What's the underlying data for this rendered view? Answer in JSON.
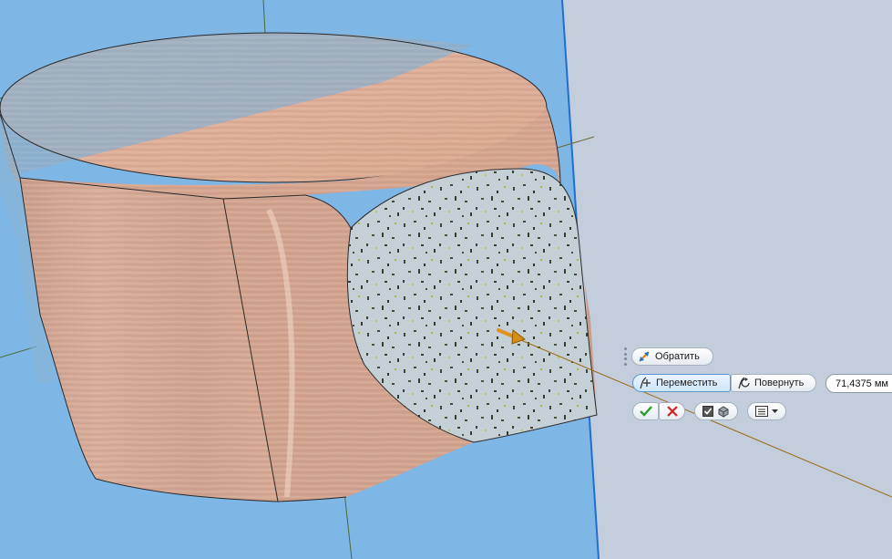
{
  "minitoolbar": {
    "flip_label": "Обратить",
    "move_label": "Переместить",
    "rotate_label": "Повернуть",
    "distance_value": "71,4375 мм"
  },
  "icons": {
    "flip": "flip-arrows-icon",
    "move": "move-icon",
    "rotate": "rotate-icon",
    "ok": "checkmark-icon",
    "cancel": "x-icon",
    "apply": "checkbox-solid-icon",
    "menu": "list-menu-icon"
  },
  "colors": {
    "viewport_bg": "#7eb6e6",
    "panel_bg": "#c3cddb",
    "ok": "#2e9e2e",
    "cancel": "#d42020",
    "manipulator": "#d78e14"
  }
}
